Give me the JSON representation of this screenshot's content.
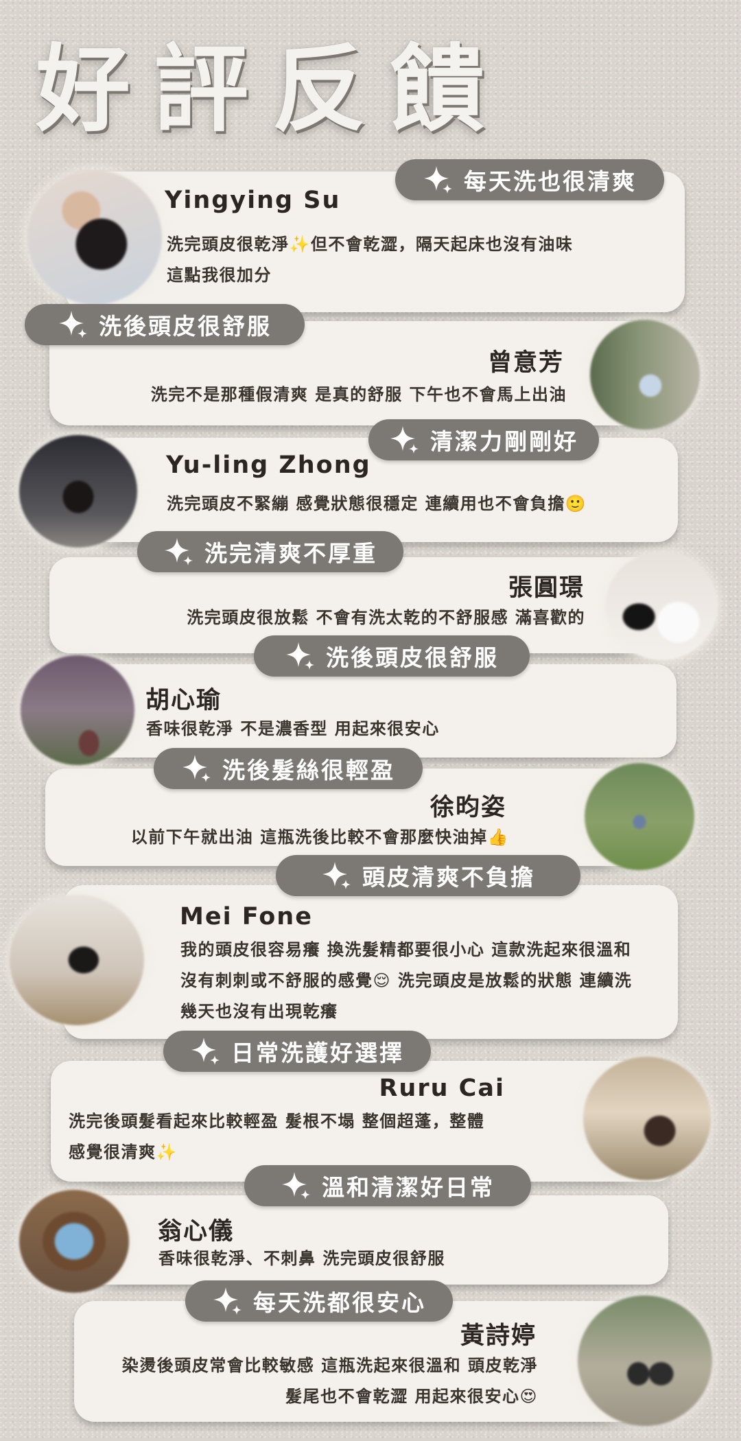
{
  "title": "好評反饋",
  "reviews": [
    {
      "name": "Yingying Su",
      "tag": "每天洗也很清爽",
      "lines": [
        "洗完頭皮很乾淨✨但不會乾澀，隔天起床也沒有油味",
        "這點我很加分"
      ]
    },
    {
      "name": "曾意芳",
      "tag": "洗後頭皮很舒服",
      "lines": [
        "洗完不是那種假清爽 是真的舒服 下午也不會馬上出油"
      ]
    },
    {
      "name": "Yu-ling Zhong",
      "tag": "清潔力剛剛好",
      "lines": [
        "洗完頭皮不緊繃 感覺狀態很穩定 連續用也不會負擔🙂"
      ]
    },
    {
      "name": "張圓璟",
      "tag": "洗完清爽不厚重",
      "lines": [
        "洗完頭皮很放鬆 不會有洗太乾的不舒服感 滿喜歡的"
      ]
    },
    {
      "name": "胡心瑜",
      "tag": "洗後頭皮很舒服",
      "lines": [
        "香味很乾淨 不是濃香型 用起來很安心"
      ]
    },
    {
      "name": "徐昀姿",
      "tag": "洗後髮絲很輕盈",
      "lines": [
        "以前下午就出油 這瓶洗後比較不會那麼快油掉👍"
      ]
    },
    {
      "name": "Mei Fone",
      "tag": "頭皮清爽不負擔",
      "lines": [
        "我的頭皮很容易癢 換洗髮精都要很小心 這款洗起來很溫和",
        "沒有刺刺或不舒服的感覺😌 洗完頭皮是放鬆的狀態 連續洗",
        "幾天也沒有出現乾癢"
      ]
    },
    {
      "name": "Ruru Cai",
      "tag": "日常洗護好選擇",
      "lines": [
        "洗完後頭髮看起來比較輕盈 髮根不塌 整個超蓬，整體",
        "感覺很清爽✨"
      ]
    },
    {
      "name": "翁心儀",
      "tag": "溫和清潔好日常",
      "lines": [
        "香味很乾淨、不刺鼻 洗完頭皮很舒服"
      ]
    },
    {
      "name": "黃詩婷",
      "tag": "每天洗都很安心",
      "lines": [
        "染燙後頭皮常會比較敏感 這瓶洗起來很溫和 頭皮乾淨",
        "髮尾也不會乾澀 用起來很安心😍"
      ]
    }
  ],
  "colors": {
    "tag_bg": "#7c7874",
    "card_bg": "#f4f1ec",
    "text": "#2b2621"
  },
  "icons": {
    "tag_icon": "sparkle-icon"
  }
}
